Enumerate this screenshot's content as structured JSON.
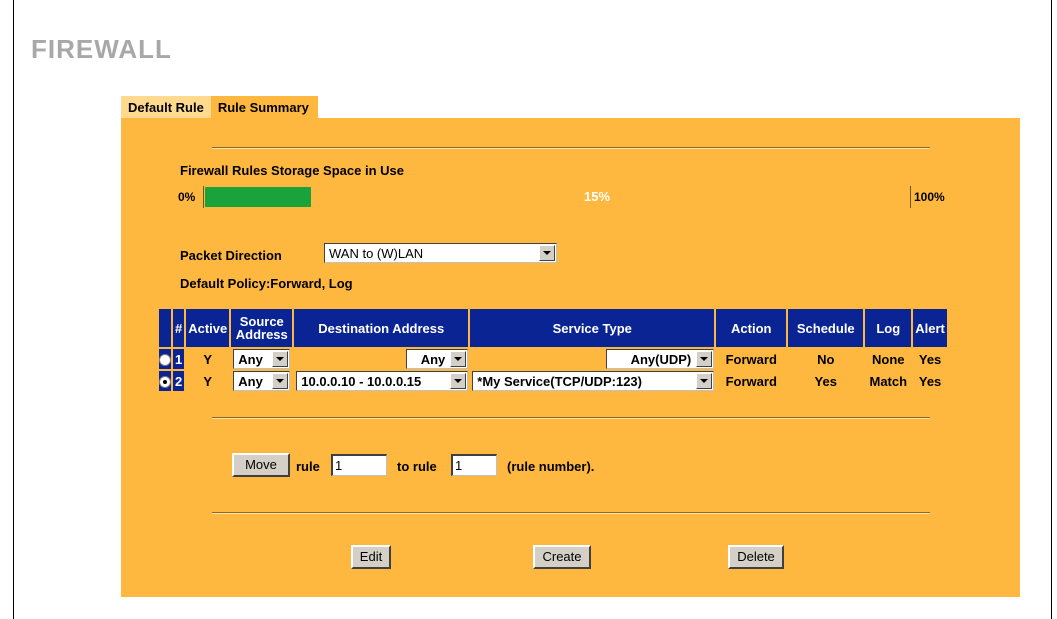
{
  "page": {
    "title": "FIREWALL"
  },
  "tabs": [
    {
      "label": "Default Rule",
      "active": false
    },
    {
      "label": "Rule Summary",
      "active": true
    }
  ],
  "storage": {
    "title": "Firewall Rules Storage Space in Use",
    "min_label": "0%",
    "max_label": "100%",
    "percent_text": "15%",
    "percent_value": 15,
    "fill_color": "#1aa33a"
  },
  "packet_direction": {
    "label": "Packet Direction",
    "value": "WAN to (W)LAN"
  },
  "default_policy": {
    "text": "Default Policy:Forward, Log"
  },
  "table": {
    "headers": {
      "num": "#",
      "active": "Active",
      "source_l1": "Source",
      "source_l2": "Address",
      "destination": "Destination Address",
      "service": "Service Type",
      "action": "Action",
      "schedule": "Schedule",
      "log": "Log",
      "alert": "Alert"
    },
    "rows": [
      {
        "num": "1",
        "selected": false,
        "active": "Y",
        "source": "Any",
        "destination": "Any",
        "service": "Any(UDP)",
        "action": "Forward",
        "schedule": "No",
        "log": "None",
        "alert": "Yes"
      },
      {
        "num": "2",
        "selected": true,
        "active": "Y",
        "source": "Any",
        "destination": "10.0.0.10 - 10.0.0.15",
        "service": "*My Service(TCP/UDP:123)",
        "action": "Forward",
        "schedule": "Yes",
        "log": "Match",
        "alert": "Yes"
      }
    ]
  },
  "move": {
    "button_label": "Move",
    "rule_label": "rule",
    "from_value": "1",
    "to_label": "to rule",
    "to_value": "1",
    "hint": "(rule number)."
  },
  "buttons": {
    "edit": "Edit",
    "create": "Create",
    "delete": "Delete"
  },
  "colors": {
    "panel": "#ffb83f",
    "header": "#0b2493",
    "title": "#a8a8a8"
  }
}
